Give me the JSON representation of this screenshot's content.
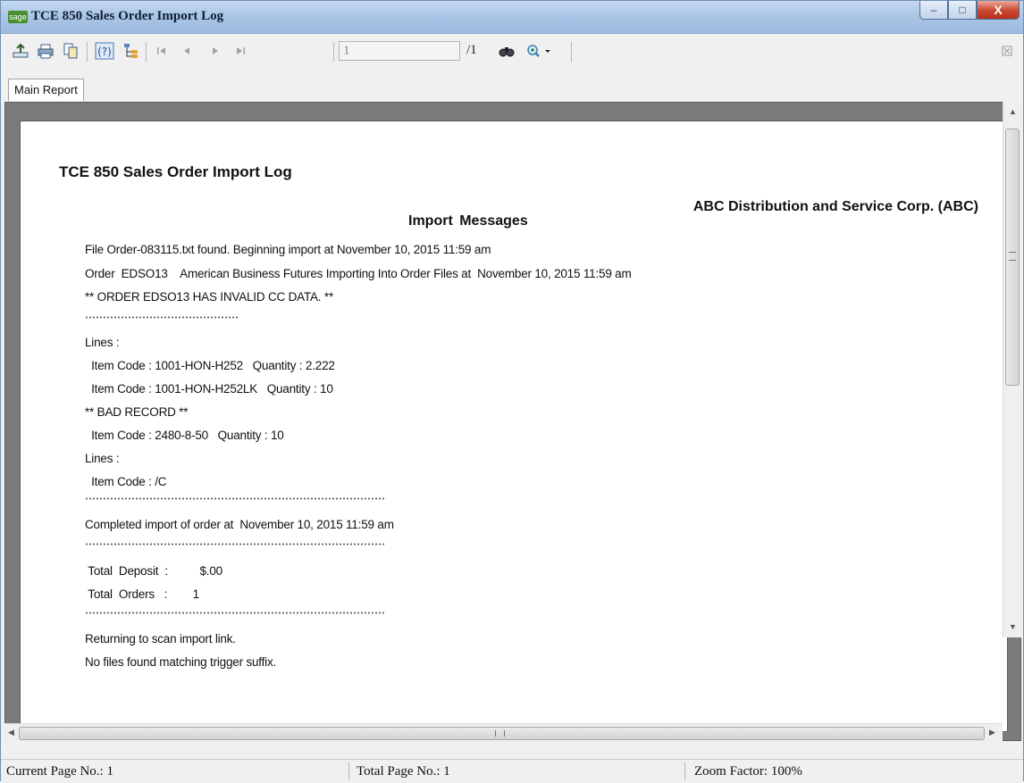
{
  "window": {
    "app_icon": "sage",
    "title": "TCE 850 Sales Order Import Log",
    "controls": {
      "minimize": "–",
      "maximize": "□",
      "close": "X"
    }
  },
  "toolbar": {
    "icons": [
      "export-icon",
      "print-icon",
      "copy-icon",
      "help-icon",
      "group-tree-icon",
      "first-page-icon",
      "previous-page-icon",
      "next-page-icon",
      "last-page-icon",
      "find-icon",
      "zoom-icon"
    ],
    "page_input": "1",
    "page_total": "/1"
  },
  "tabs": [
    {
      "label": "Main Report"
    }
  ],
  "report": {
    "title": "TCE 850 Sales Order Import Log",
    "company": "ABC Distribution and Service Corp. (ABC)",
    "section_heading": "Import  Messages",
    "lines": {
      "l1": "File Order-083115.txt found. Beginning import at November 10, 2015 11:59 am",
      "l2": "Order  EDSO13    American Business Futures Importing Into Order Files at  November 10, 2015 11:59 am",
      "l3": "** ORDER EDSO13 HAS INVALID CC DATA. **",
      "l4": "Lines :",
      "l5": "  Item Code : 1001-HON-H252   Quantity : 2.222",
      "l6": "  Item Code : 1001-HON-H252LK   Quantity : 10",
      "l7": "** BAD RECORD **",
      "l8": "  Item Code : 2480-8-50   Quantity : 10",
      "l9": "Lines :",
      "l10": "  Item Code : /C",
      "l11": "Completed import of order at  November 10, 2015 11:59 am",
      "l12": " Total  Deposit  :          $.00",
      "l13": " Total  Orders   :        1",
      "l14": "Returning to scan import link.",
      "l15": "No files found matching trigger suffix."
    }
  },
  "status": {
    "current_page": "Current Page No.: 1",
    "total_page": "Total Page No.: 1",
    "zoom": "Zoom Factor: 100%"
  }
}
